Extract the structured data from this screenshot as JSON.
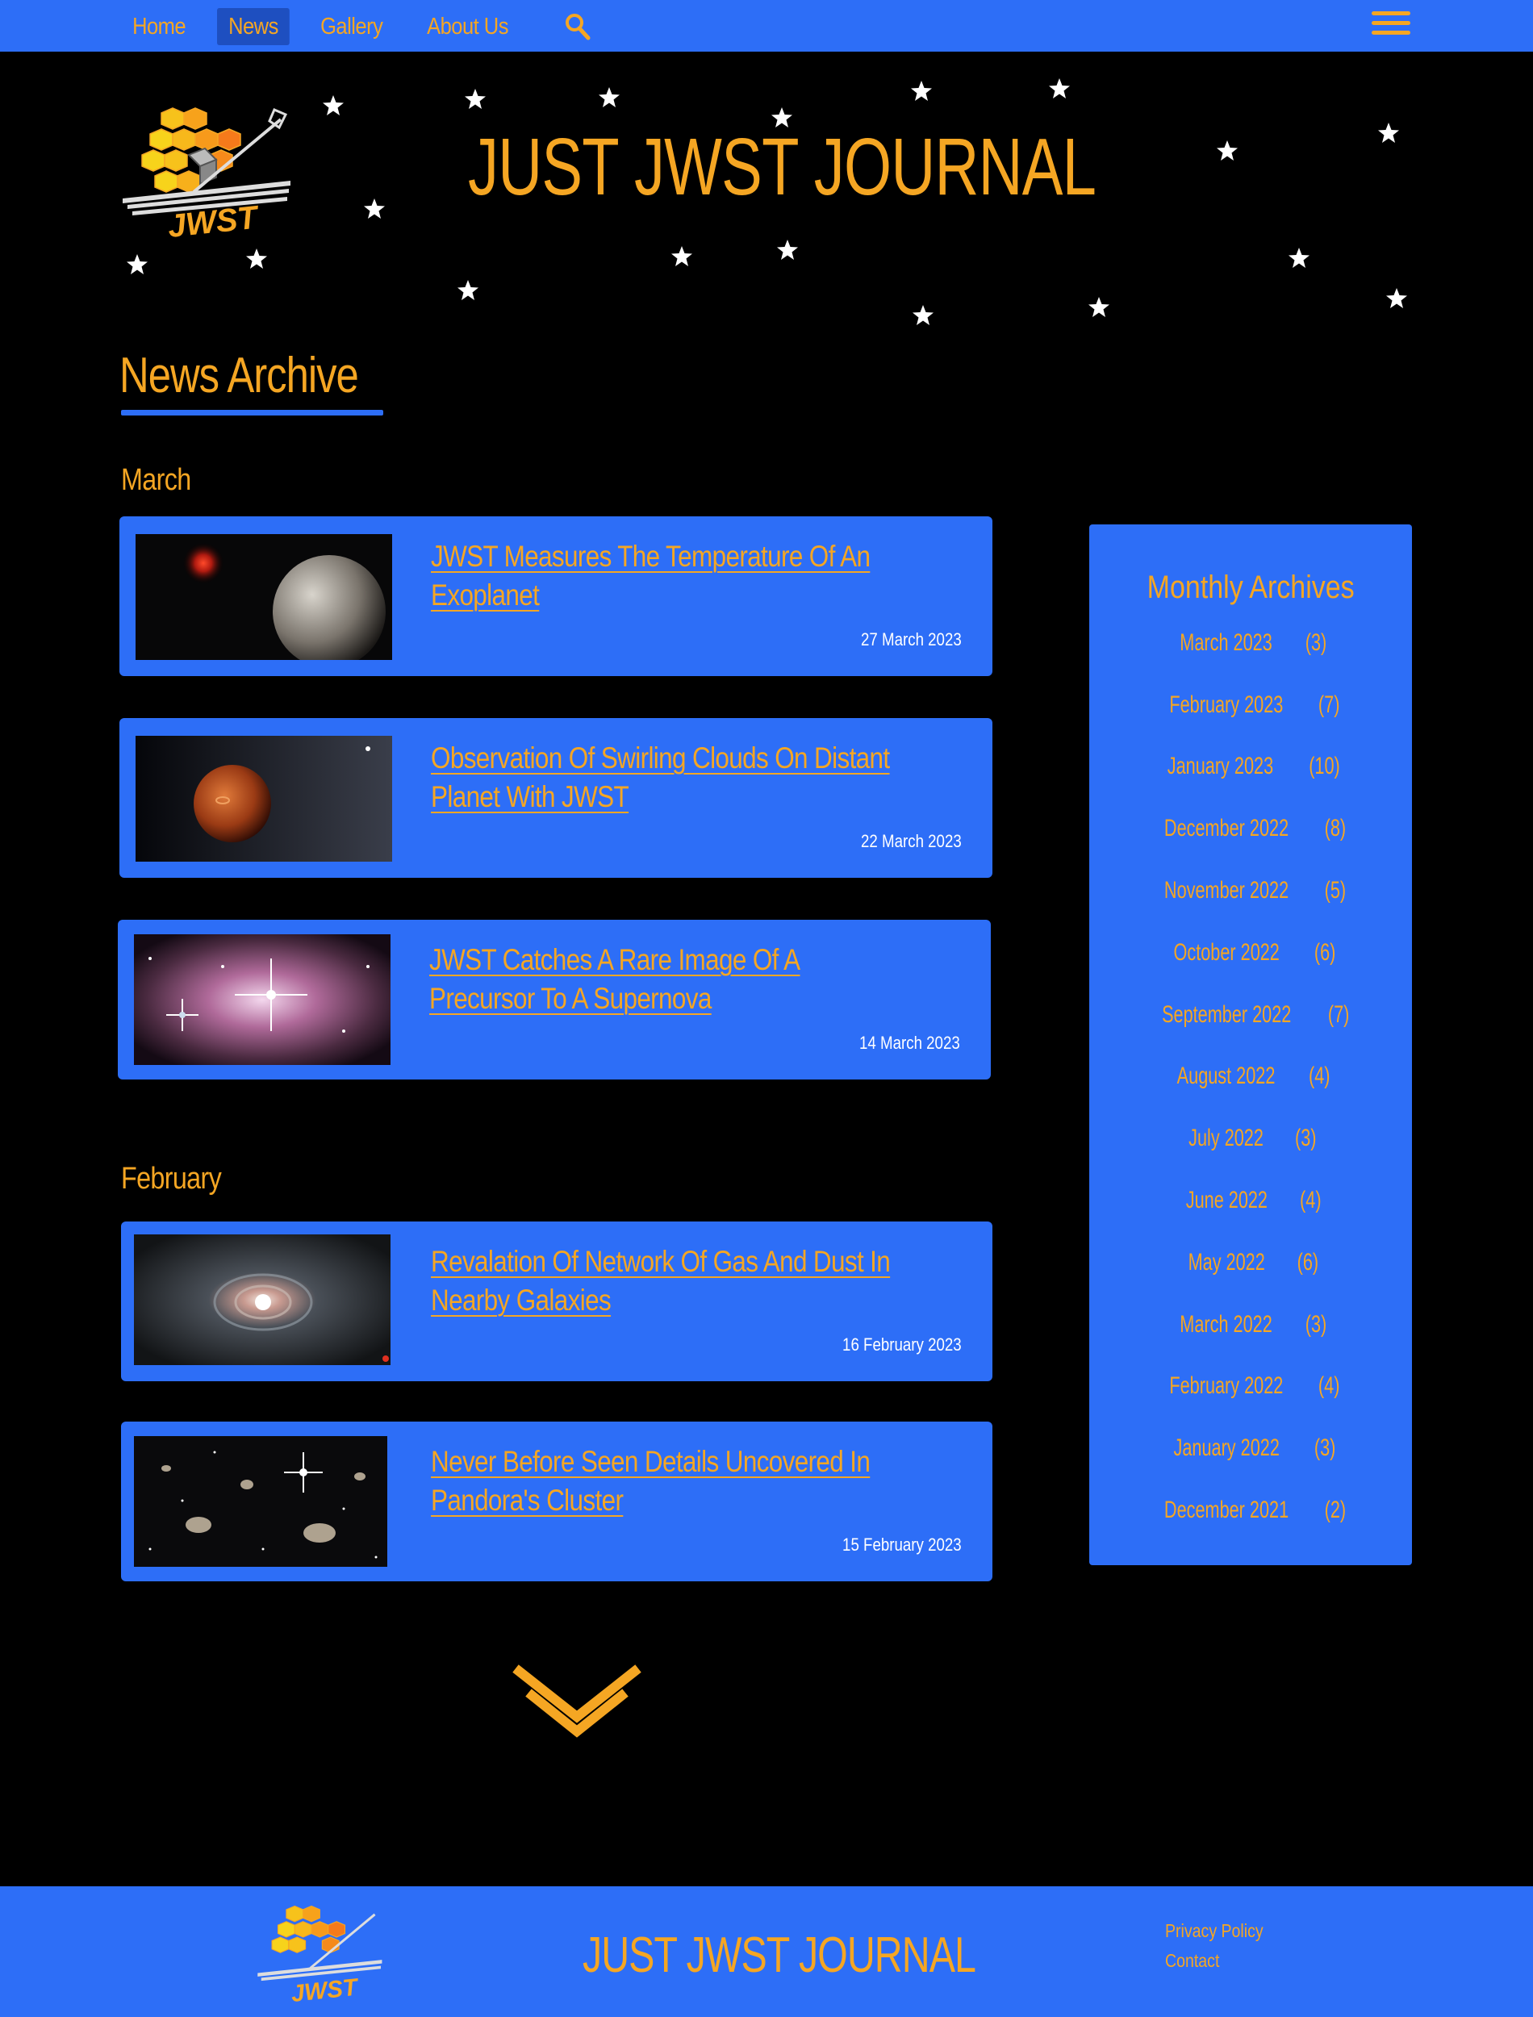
{
  "nav": {
    "items": [
      {
        "label": "Home",
        "active": false
      },
      {
        "label": "News",
        "active": true
      },
      {
        "label": "Gallery",
        "active": false
      },
      {
        "label": "About Us",
        "active": false
      }
    ]
  },
  "header": {
    "title": "JUST JWST JOURNAL"
  },
  "archive": {
    "heading": "News Archive",
    "months": [
      {
        "name": "March",
        "articles": [
          {
            "title": "JWST Measures The Temperature Of An Exoplanet",
            "date": "27 March 2023"
          },
          {
            "title": "Observation Of Swirling Clouds On Distant Planet With JWST",
            "date": "22 March 2023"
          },
          {
            "title": "JWST Catches A Rare Image Of A Precursor To A Supernova",
            "date": "14 March 2023"
          }
        ]
      },
      {
        "name": "February",
        "articles": [
          {
            "title": "Revalation Of Network Of Gas And Dust In Nearby Galaxies",
            "date": "16 February 2023"
          },
          {
            "title": "Never Before Seen Details Uncovered In Pandora's Cluster",
            "date": "15 February 2023"
          }
        ]
      }
    ]
  },
  "sidebar": {
    "title": "Monthly Archives",
    "items": [
      {
        "month": "March 2023",
        "count": "(3)"
      },
      {
        "month": "February 2023",
        "count": "(7)"
      },
      {
        "month": "January 2023",
        "count": "(10)"
      },
      {
        "month": "December 2022",
        "count": "(8)"
      },
      {
        "month": "November 2022",
        "count": "(5)"
      },
      {
        "month": "October 2022",
        "count": "(6)"
      },
      {
        "month": "September 2022",
        "count": "(7)"
      },
      {
        "month": "August 2022",
        "count": "(4)"
      },
      {
        "month": "July 2022",
        "count": "(3)"
      },
      {
        "month": "June 2022",
        "count": "(4)"
      },
      {
        "month": "May 2022",
        "count": "(6)"
      },
      {
        "month": "March 2022",
        "count": "(3)"
      },
      {
        "month": "February 2022",
        "count": "(4)"
      },
      {
        "month": "January 2022",
        "count": "(3)"
      },
      {
        "month": "December 2021",
        "count": "(2)"
      }
    ]
  },
  "footer": {
    "title": "JUST JWST JOURNAL",
    "links": [
      "Privacy Policy",
      "Contact"
    ]
  },
  "colors": {
    "accent": "#f5a623",
    "brand_blue": "#2d6ef7",
    "background": "#000000"
  },
  "icons": {
    "search": "search-icon",
    "menu": "hamburger-menu-icon",
    "more": "chevron-down-icon"
  }
}
